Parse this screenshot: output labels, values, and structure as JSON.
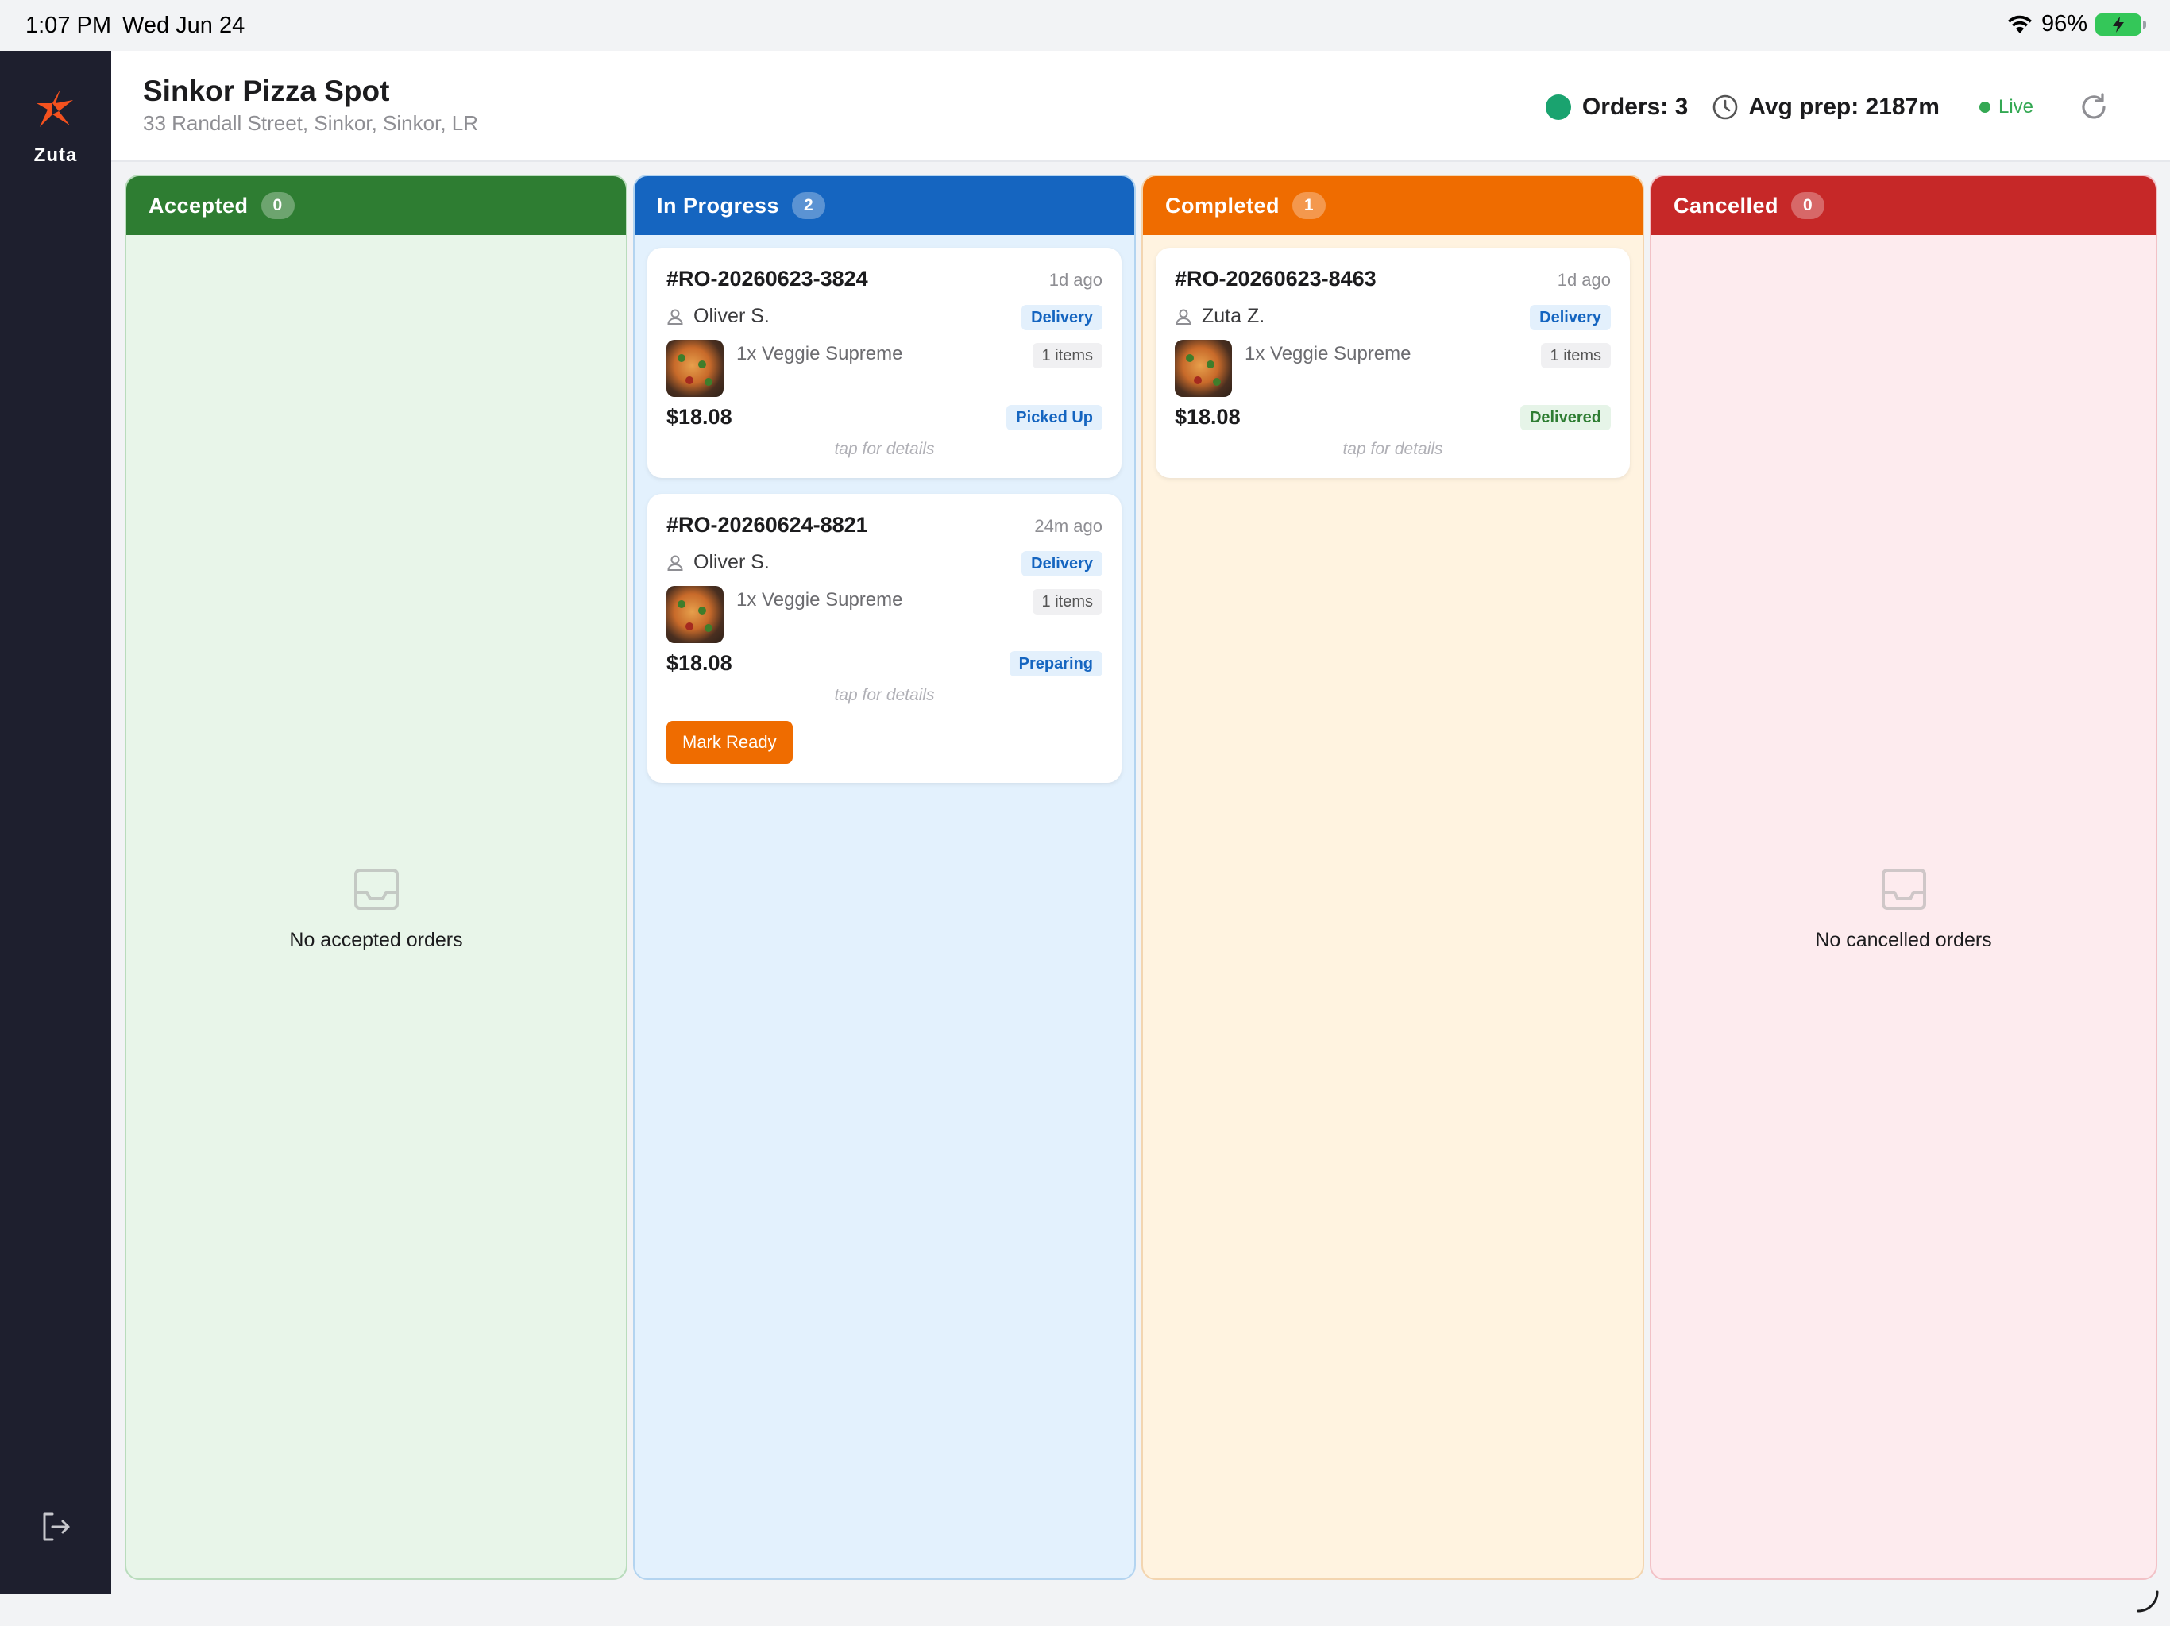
{
  "status_bar": {
    "time": "1:07 PM",
    "date": "Wed Jun 24",
    "battery": "96%"
  },
  "sidebar": {
    "brand": "Zuta",
    "logo_icon": "zuta-star-logo",
    "logout_icon": "logout-icon"
  },
  "header": {
    "store_name": "Sinkor Pizza Spot",
    "store_address": "33 Randall Street, Sinkor, Sinkor, LR",
    "orders": "Orders: 3",
    "avg_prep": "Avg prep: 2187m",
    "live": "Live"
  },
  "colors": {
    "accepted": "#2e7d32",
    "in_progress": "#1565c0",
    "completed": "#ef6c00",
    "cancelled": "#c62828"
  },
  "columns": [
    {
      "title": "Accepted",
      "count": "0",
      "empty_text": "No accepted orders",
      "orders": []
    },
    {
      "title": "In Progress",
      "count": "2",
      "orders": [
        {
          "id": "#RO-20260623-3824",
          "ago": "1d ago",
          "customer": "Oliver S.",
          "type": "Delivery",
          "item": "1x Veggie Supreme",
          "items_count": "1 items",
          "price": "$18.08",
          "status": "Picked Up",
          "tap": "tap for details"
        },
        {
          "id": "#RO-20260624-8821",
          "ago": "24m ago",
          "customer": "Oliver S.",
          "type": "Delivery",
          "item": "1x Veggie Supreme",
          "items_count": "1 items",
          "price": "$18.08",
          "status": "Preparing",
          "tap": "tap for details",
          "action": "Mark Ready"
        }
      ]
    },
    {
      "title": "Completed",
      "count": "1",
      "orders": [
        {
          "id": "#RO-20260623-8463",
          "ago": "1d ago",
          "customer": "Zuta Z.",
          "type": "Delivery",
          "item": "1x Veggie Supreme",
          "items_count": "1 items",
          "price": "$18.08",
          "status": "Delivered",
          "tap": "tap for details"
        }
      ]
    },
    {
      "title": "Cancelled",
      "count": "0",
      "empty_text": "No cancelled orders",
      "orders": []
    }
  ]
}
